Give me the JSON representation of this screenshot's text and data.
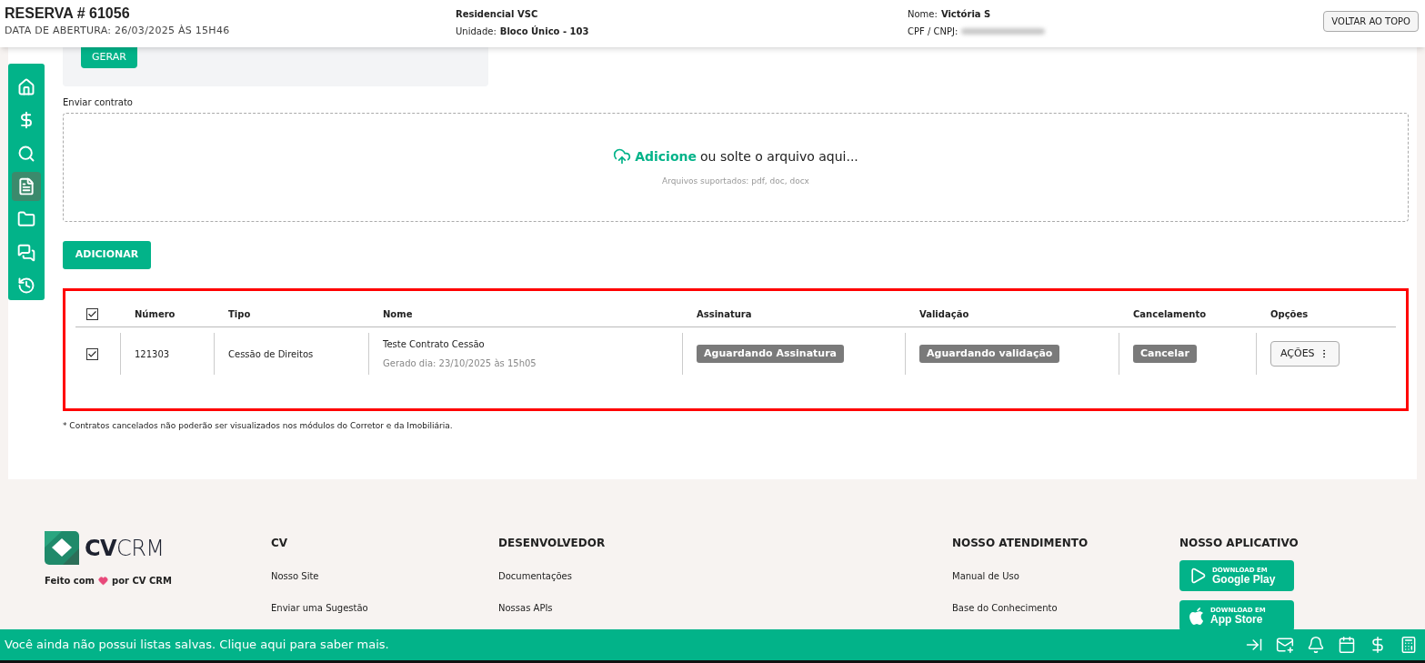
{
  "header": {
    "title": "RESERVA # 61056",
    "opened": "DATA DE ABERTURA: 26/03/2025 ÀS 15H46",
    "project": "Residencial VSC",
    "unit_label": "Unidade:",
    "unit": "Bloco Único - 103",
    "name_label": "Nome:",
    "name": "Victória S",
    "cpf_label": "CPF / CNPJ:",
    "back_button": "VOLTAR AO TOPO"
  },
  "sidebar": {
    "items": [
      {
        "kind": "home",
        "selected": false
      },
      {
        "kind": "dollar",
        "selected": false
      },
      {
        "kind": "search",
        "selected": false
      },
      {
        "kind": "document",
        "selected": true
      },
      {
        "kind": "folder",
        "selected": false
      },
      {
        "kind": "chat",
        "selected": false
      },
      {
        "kind": "history",
        "selected": false
      }
    ]
  },
  "generate_button": "GERAR",
  "upload": {
    "label": "Enviar contrato",
    "link": "Adicione",
    "text": "ou solte o arquivo aqui...",
    "hint": "Arquivos suportados: pdf, doc, docx"
  },
  "add_button": "ADICIONAR",
  "table": {
    "header_checked": true,
    "columns": [
      "Número",
      "Tipo",
      "Nome",
      "Assinatura",
      "Validação",
      "Cancelamento",
      "Opções"
    ],
    "rows": [
      {
        "checked": true,
        "number": "121303",
        "type": "Cessão de Direitos",
        "name": "Teste Contrato Cessão",
        "generated": "Gerado dia: 23/10/2025 às 15h05",
        "signature": "Aguardando Assinatura",
        "validation": "Aguardando validação",
        "cancel": "Cancelar",
        "actions": "AÇÕES"
      }
    ]
  },
  "note": "* Contratos cancelados não poderão ser visualizados nos módulos do Corretor e da Imobiliária.",
  "footer": {
    "logo_bold": "CV",
    "logo_light": "CRM",
    "made_with": "Feito com",
    "made_by": "por CV CRM",
    "columns": [
      {
        "title": "CV",
        "links": [
          "Nosso Site",
          "Enviar uma Sugestão"
        ]
      },
      {
        "title": "DESENVOLVEDOR",
        "links": [
          "Documentações",
          "Nossas APIs"
        ]
      },
      {
        "title": "NOSSO ATENDIMENTO",
        "links": [
          "Manual de Uso",
          "Base do Conhecimento"
        ]
      }
    ],
    "apps": {
      "title": "NOSSO APLICATIVO",
      "stores": [
        {
          "kind": "google",
          "small": "DOWNLOAD EM",
          "name": "Google Play"
        },
        {
          "kind": "apple",
          "small": "DOWNLOAD EM",
          "name": "App Store"
        }
      ]
    }
  },
  "bottom_bar": {
    "message": "Você ainda não possui listas salvas. Clique aqui para saber mais.",
    "icons": [
      {
        "kind": "collapse"
      },
      {
        "kind": "mail"
      },
      {
        "kind": "bell"
      },
      {
        "kind": "calendar"
      },
      {
        "kind": "dollar"
      },
      {
        "kind": "calculator"
      }
    ]
  }
}
